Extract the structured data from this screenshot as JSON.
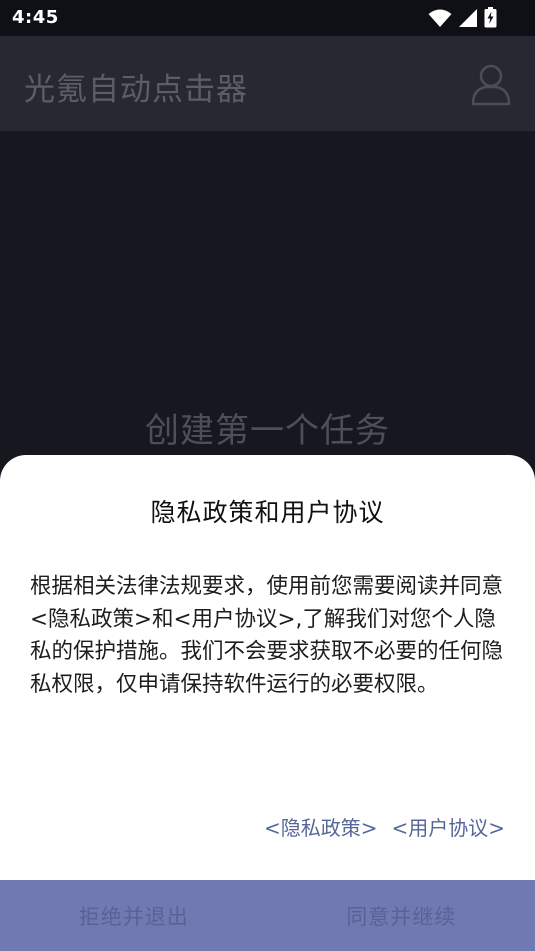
{
  "status_bar": {
    "time": "4:45",
    "icons": [
      "wifi-icon",
      "signal-icon",
      "battery-charging-icon"
    ]
  },
  "app_bar": {
    "title": "光氪自动点击器",
    "user_icon": "user-icon"
  },
  "main": {
    "empty_title": "创建第一个任务"
  },
  "dialog": {
    "title": "隐私政策和用户协议",
    "body": "根据相关法律法规要求，使用前您需要阅读并同意<隐私政策>和<用户协议>,了解我们对您个人隐私的保护措施。我们不会要求获取不必要的任何隐私权限，仅申请保持软件运行的必要权限。",
    "link_privacy": "<隐私政策>",
    "link_agreement": "<用户协议>",
    "reject_label": "拒绝并退出",
    "accept_label": "同意并继续"
  },
  "colors": {
    "accent_bar": "#7179b3",
    "link": "#56679a"
  }
}
